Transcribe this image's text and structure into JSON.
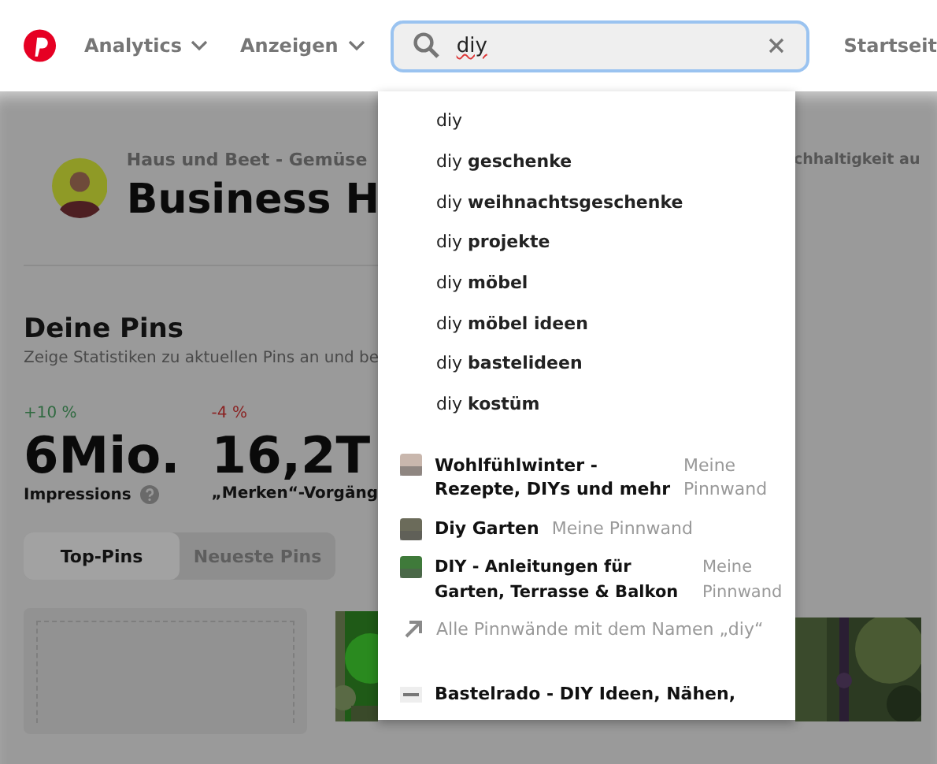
{
  "nav": {
    "items": [
      {
        "label": "Analytics"
      },
      {
        "label": "Anzeigen"
      }
    ],
    "right_link": "Startseit"
  },
  "search": {
    "value": "diy"
  },
  "profile": {
    "subtitle_left": "Haus und Beet - Gemüse",
    "subtitle_right": "chhaltigkeit au",
    "title": "Business H"
  },
  "pins": {
    "heading": "Deine Pins",
    "description": "Zeige Statistiken zu aktuellen Pins an und be",
    "stats": [
      {
        "change": "+10 %",
        "kind": "up",
        "value": "6Mio.",
        "label": "Impressions",
        "help": true
      },
      {
        "change": "-4 %",
        "kind": "down",
        "value": "16,2T",
        "label": "„Merken“-Vorgäng",
        "help": false
      }
    ],
    "tabs": [
      {
        "label": "Top-Pins",
        "selected": true
      },
      {
        "label": "Neueste Pins",
        "selected": false
      }
    ]
  },
  "suggestions": [
    "diy",
    "diy **geschenke**",
    "diy **weihnachtsgeschenke**",
    "diy **projekte**",
    "diy **möbel**",
    "diy **möbel ideen**",
    "diy **bastelideen**",
    "diy **kostüm**"
  ],
  "boards": [
    {
      "title": "Wohlfühlwinter - Rezepte, DIYs und mehr",
      "owner": "Meine Pinnwand",
      "inline": false
    },
    {
      "title": "Diy Garten",
      "owner": "Meine Pinnwand",
      "inline": true
    },
    {
      "title": "DIY - Anleitungen für Garten, Terrasse & Balkon",
      "owner": "Meine Pinnwand",
      "inline": false
    }
  ],
  "all_boards_link": "Alle Pinnwände mit dem Namen „diy“",
  "more_result": "Bastelrado - DIY Ideen, Nähen,"
}
